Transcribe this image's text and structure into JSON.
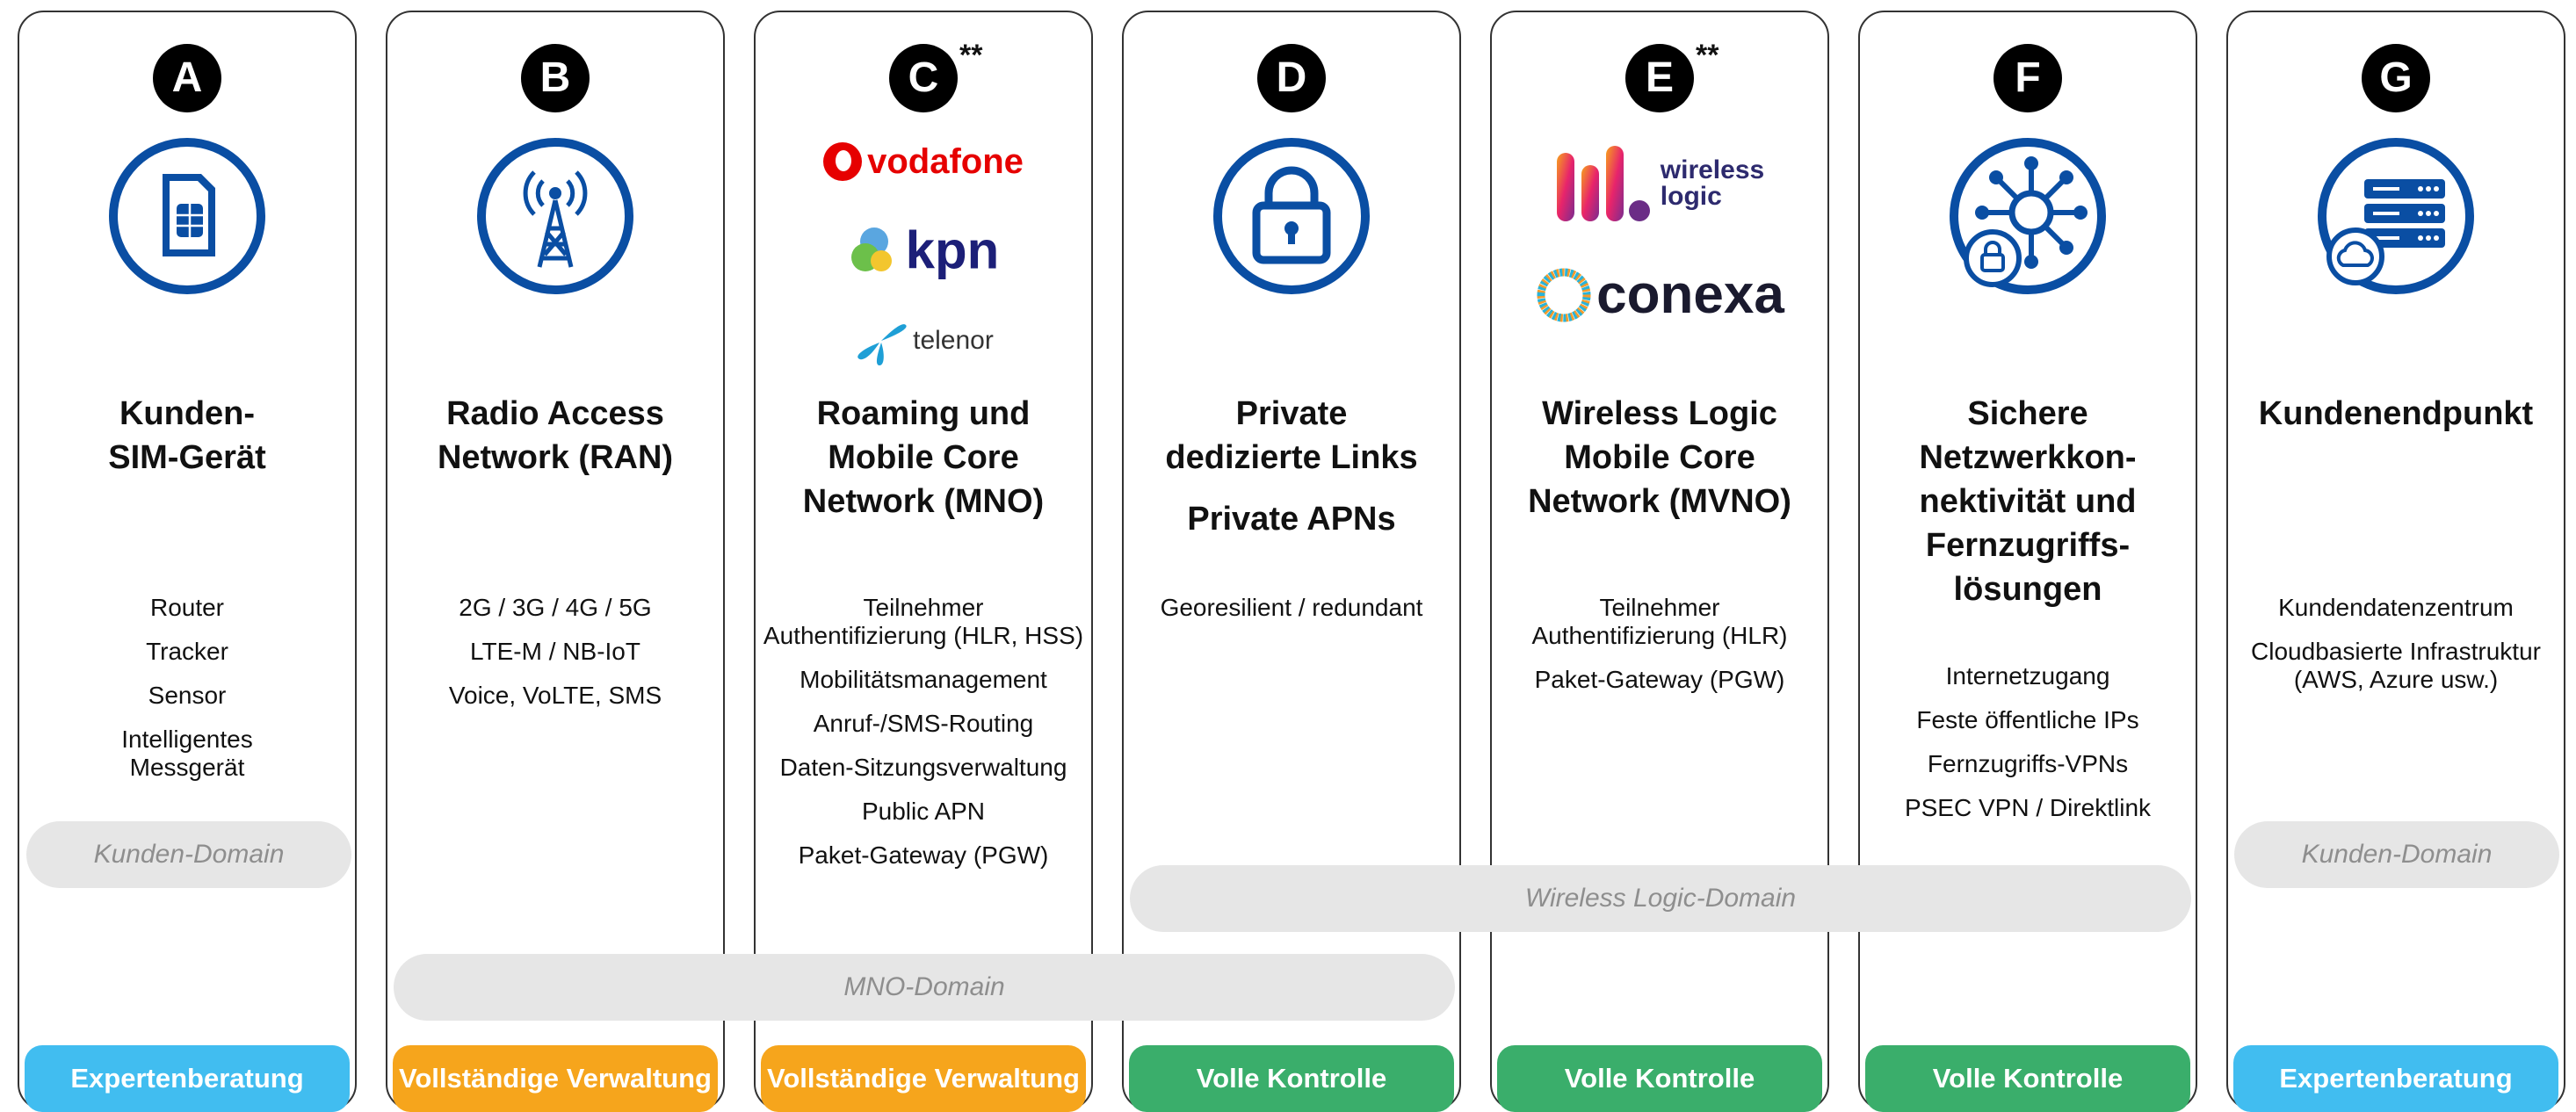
{
  "columns": [
    {
      "letter": "A",
      "title": "Kunden-\nSIM-Gerät",
      "items": [
        "Router",
        "Tracker",
        "Sensor",
        "Intelligentes\nMessgerät"
      ],
      "action": "Expertenberatung",
      "icon": "sim-card-icon"
    },
    {
      "letter": "B",
      "title": "Radio Access\nNetwork (RAN)",
      "items": [
        "2G / 3G / 4G / 5G",
        "LTE-M / NB-IoT",
        "Voice, VoLTE, SMS"
      ],
      "action": "Vollständige Verwaltung",
      "icon": "radio-tower-icon"
    },
    {
      "letter": "C",
      "stars": "**",
      "title": "Roaming und\nMobile Core\nNetwork (MNO)",
      "items": [
        "Teilnehmer\nAuthentifizierung (HLR, HSS)",
        "Mobilitätsmanagement",
        "Anruf-/SMS-Routing",
        "Daten-Sitzungsverwaltung",
        "Public APN",
        "Paket-Gateway (PGW)"
      ],
      "logos": [
        "vodafone",
        "kpn",
        "telenor"
      ],
      "action": "Vollständige Verwaltung"
    },
    {
      "letter": "D",
      "title": "Private\ndedizierte Links",
      "title2": "Private APNs",
      "items": [
        "Georesilient / redundant"
      ],
      "action": "Volle Kontrolle",
      "icon": "padlock-icon"
    },
    {
      "letter": "E",
      "stars": "**",
      "title": "Wireless Logic\nMobile Core\nNetwork (MVNO)",
      "items": [
        "Teilnehmer\nAuthentifizierung (HLR)",
        "Paket-Gateway (PGW)"
      ],
      "logos": [
        "wireless\nlogic",
        "conexa"
      ],
      "action": "Volle Kontrolle"
    },
    {
      "letter": "F",
      "title": "Sichere\nNetzwerkkon-\nnektivität und\nFernzugriffs-\nlösungen",
      "items": [
        "Internetzugang",
        "Feste öffentliche IPs",
        "Fernzugriffs-VPNs",
        "PSEC VPN / Direktlink"
      ],
      "action": "Volle Kontrolle",
      "icon": "network-lock-icon"
    },
    {
      "letter": "G",
      "title": "Kundenendpunkt",
      "items": [
        "Kundendatenzentrum",
        "Cloudbasierte Infrastruktur\n(AWS, Azure usw.)"
      ],
      "action": "Expertenberatung",
      "icon": "server-cloud-icon"
    }
  ],
  "domains": {
    "customer_a": "Kunden-Domain",
    "customer_g": "Kunden-Domain",
    "wireless": "Wireless Logic-Domain",
    "mno": "MNO-Domain"
  },
  "colors": {
    "blue_icon": "#0a4ea3",
    "expert": "#41bdf0",
    "managed": "#f6a51c",
    "control": "#3aae6b",
    "domain_bg": "#e6e6e6"
  }
}
